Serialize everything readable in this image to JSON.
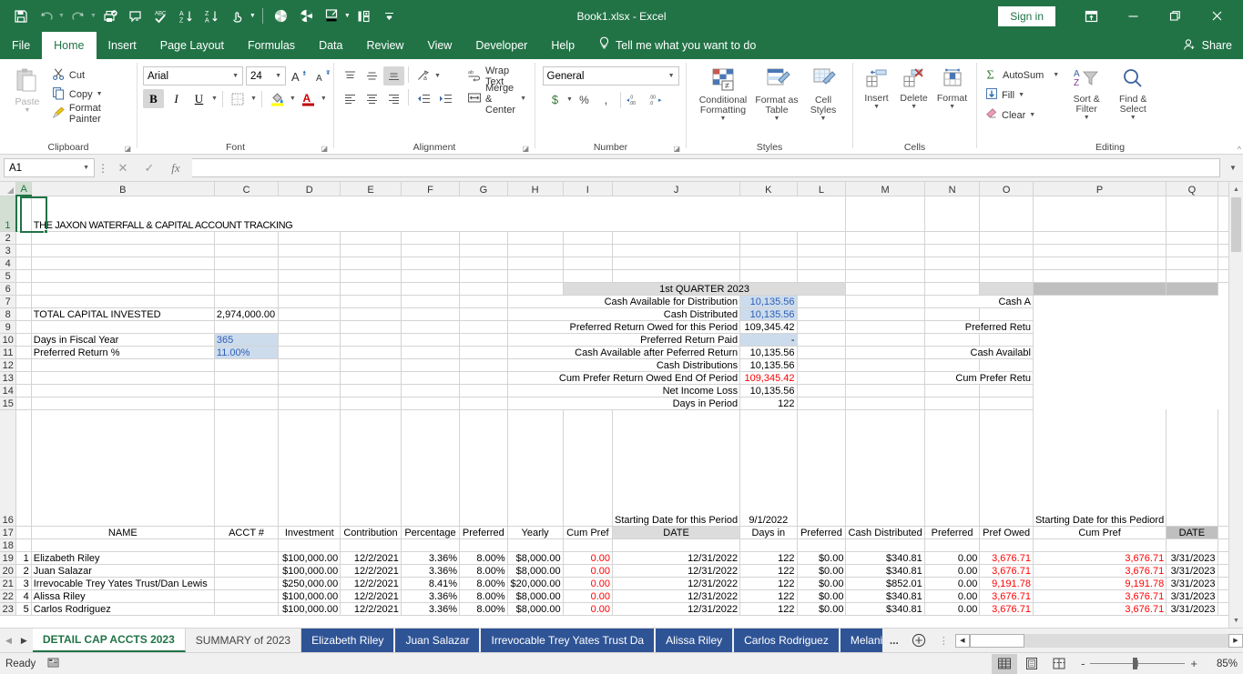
{
  "titlebar": {
    "title": "Book1.xlsx  -  Excel",
    "signin": "Sign in",
    "qat": [
      "save-icon",
      "undo-icon",
      "redo-icon",
      "print-preview-icon",
      "new-comment-icon",
      "spelling-icon",
      "sort-asc-icon",
      "sort-desc-icon",
      "touch-mode-icon",
      "pie-chart-icon",
      "pie-chart-filled-icon",
      "format-painter-icon",
      "insert-cells-icon",
      "customize-qat-icon"
    ],
    "window": [
      "ribbon-display-options",
      "minimize",
      "restore",
      "close"
    ]
  },
  "ribbon_tabs": {
    "items": [
      "File",
      "Home",
      "Insert",
      "Page Layout",
      "Formulas",
      "Data",
      "Review",
      "View",
      "Developer",
      "Help"
    ],
    "active": "Home",
    "tellme": "Tell me what you want to do",
    "share": "Share"
  },
  "ribbon": {
    "clipboard": {
      "title": "Clipboard",
      "paste": "Paste",
      "cut": "Cut",
      "copy": "Copy",
      "format_painter": "Format Painter"
    },
    "font": {
      "title": "Font",
      "font_name": "Arial",
      "font_size": "24",
      "bold": "B",
      "italic": "I",
      "underline": "U"
    },
    "alignment": {
      "title": "Alignment",
      "wrap_text": "Wrap Text",
      "merge_center": "Merge & Center"
    },
    "number": {
      "title": "Number",
      "format": "General",
      "currency": "$",
      "percent": "%",
      "comma": ","
    },
    "styles": {
      "title": "Styles",
      "conditional_formatting": "Conditional Formatting",
      "format_as_table": "Format as Table",
      "cell_styles": "Cell Styles"
    },
    "cells": {
      "title": "Cells",
      "insert": "Insert",
      "delete": "Delete",
      "format": "Format"
    },
    "editing": {
      "title": "Editing",
      "autosum": "AutoSum",
      "fill": "Fill",
      "clear": "Clear",
      "sort_filter": "Sort & Filter",
      "find_select": "Find & Select"
    }
  },
  "formula_bar": {
    "name_box": "A1",
    "formula": "",
    "cancel": "cancel-icon",
    "enter": "confirm-icon",
    "fx": "fx"
  },
  "grid": {
    "columns": [
      "A",
      "B",
      "C",
      "D",
      "E",
      "F",
      "G",
      "H",
      "I",
      "J",
      "K",
      "L",
      "M",
      "N",
      "O",
      "P",
      "Q"
    ],
    "rows": [
      "1",
      "2",
      "3",
      "4",
      "5",
      "6",
      "7",
      "8",
      "9",
      "10",
      "11",
      "12",
      "13",
      "14",
      "15",
      "16",
      "17",
      "18",
      "19",
      "20",
      "21",
      "22",
      "23"
    ],
    "active_cell": "A1",
    "title": "THE JAXON WATERFALL & CAPITAL ACCOUNT TRACKING",
    "summary": {
      "total_capital_invested_label": "TOTAL CAPITAL INVESTED",
      "total_capital_invested_value": "2,974,000.00",
      "days_in_fiscal_year_label": "Days in Fiscal Year",
      "days_in_fiscal_year_value": "365",
      "preferred_return_pct_label": "Preferred Return %",
      "preferred_return_pct_value": "11.00%"
    },
    "quarter1": {
      "heading": "1st QUARTER 2023",
      "lines": [
        {
          "label": "Cash Available for Distribution",
          "value": "10,135.56"
        },
        {
          "label": "Cash Distributed",
          "value": "10,135.56"
        },
        {
          "label": "Preferred Return Owed for this Period",
          "value": "109,345.42"
        },
        {
          "label": "Preferred Return Paid",
          "value": "-"
        },
        {
          "label": "Cash Available after Peferred Return",
          "value": "10,135.56"
        },
        {
          "label": "Cash Distributions",
          "value": "10,135.56"
        },
        {
          "label": "Cum Prefer Return Owed End Of Period",
          "value": "109,345.42"
        },
        {
          "label": "Net Income Loss",
          "value": "10,135.56"
        },
        {
          "label": "Days in Period",
          "value": "122"
        }
      ]
    },
    "quarter2_clipped": {
      "l7": "Cash A",
      "l9": "Preferred Retu",
      "l11": "Cash Availabl",
      "l13": "Cum Prefer Retu"
    },
    "starting_date": {
      "label_j16": "Starting Date for this Period",
      "value_k16": "9/1/2022",
      "label_p16": "Starting Date for this Pediord"
    },
    "table_headers": [
      "",
      "NAME",
      "ACCT #",
      "Investment",
      "Contribution",
      "Percentage",
      "Preferred",
      "Yearly",
      "Cum Pref",
      "DATE",
      "Days in",
      "Preferred",
      "Cash Distributed",
      "Preferred",
      "Pref Owed",
      "Cum Pref",
      "DATE"
    ],
    "table_rows": [
      {
        "num": "1",
        "name": "Elizabeth Riley",
        "acct": "",
        "investment": "$100,000.00",
        "contribution": "12/2/2021",
        "percentage": "3.36%",
        "preferred": "8.00%",
        "yearly": "$8,000.00",
        "cumpref": "0.00",
        "date": "12/31/2022",
        "daysin": "122",
        "preferred2": "$0.00",
        "cashdist": "$340.81",
        "preferred3": "0.00",
        "prefowed": "3,676.71",
        "cumpref2": "3,676.71",
        "date2": "3/31/2023"
      },
      {
        "num": "2",
        "name": "Juan Salazar",
        "acct": "",
        "investment": "$100,000.00",
        "contribution": "12/2/2021",
        "percentage": "3.36%",
        "preferred": "8.00%",
        "yearly": "$8,000.00",
        "cumpref": "0.00",
        "date": "12/31/2022",
        "daysin": "122",
        "preferred2": "$0.00",
        "cashdist": "$340.81",
        "preferred3": "0.00",
        "prefowed": "3,676.71",
        "cumpref2": "3,676.71",
        "date2": "3/31/2023"
      },
      {
        "num": "3",
        "name": "Irrevocable Trey Yates Trust/Dan Lewis",
        "acct": "",
        "investment": "$250,000.00",
        "contribution": "12/2/2021",
        "percentage": "8.41%",
        "preferred": "8.00%",
        "yearly": "$20,000.00",
        "cumpref": "0.00",
        "date": "12/31/2022",
        "daysin": "122",
        "preferred2": "$0.00",
        "cashdist": "$852.01",
        "preferred3": "0.00",
        "prefowed": "9,191.78",
        "cumpref2": "9,191.78",
        "date2": "3/31/2023"
      },
      {
        "num": "4",
        "name": "Alissa Riley",
        "acct": "",
        "investment": "$100,000.00",
        "contribution": "12/2/2021",
        "percentage": "3.36%",
        "preferred": "8.00%",
        "yearly": "$8,000.00",
        "cumpref": "0.00",
        "date": "12/31/2022",
        "daysin": "122",
        "preferred2": "$0.00",
        "cashdist": "$340.81",
        "preferred3": "0.00",
        "prefowed": "3,676.71",
        "cumpref2": "3,676.71",
        "date2": "3/31/2023"
      },
      {
        "num": "5",
        "name": "Carlos Rodriguez",
        "acct": "",
        "investment": "$100,000.00",
        "contribution": "12/2/2021",
        "percentage": "3.36%",
        "preferred": "8.00%",
        "yearly": "$8,000.00",
        "cumpref": "0.00",
        "date": "12/31/2022",
        "daysin": "122",
        "preferred2": "$0.00",
        "cashdist": "$340.81",
        "preferred3": "0.00",
        "prefowed": "3,676.71",
        "cumpref2": "3,676.71",
        "date2": "3/31/2023"
      }
    ]
  },
  "sheet_tabs": {
    "items": [
      {
        "label": "DETAIL CAP ACCTS 2023",
        "state": "active"
      },
      {
        "label": "SUMMARY of 2023",
        "state": "normal"
      },
      {
        "label": "Elizabeth Riley",
        "state": "blue"
      },
      {
        "label": "Juan Salazar",
        "state": "blue"
      },
      {
        "label": "Irrevocable Trey Yates Trust Da",
        "state": "blue"
      },
      {
        "label": "Alissa Riley",
        "state": "blue"
      },
      {
        "label": "Carlos Rodriguez",
        "state": "blue"
      },
      {
        "label": "Melani",
        "state": "blue"
      }
    ],
    "overflow": "...",
    "add_sheet": "new-sheet-icon"
  },
  "status_bar": {
    "status": "Ready",
    "accessibility": "accessibility-icon",
    "views": [
      "normal-view",
      "page-layout-view",
      "page-break-preview"
    ],
    "zoom": "85%",
    "zoom_out": "-",
    "zoom_in": "+"
  },
  "colors": {
    "excel_green": "#217346",
    "tab_blue": "#2f5496",
    "value_blue": "#2f5eb8",
    "negative_red": "#ff0000"
  }
}
